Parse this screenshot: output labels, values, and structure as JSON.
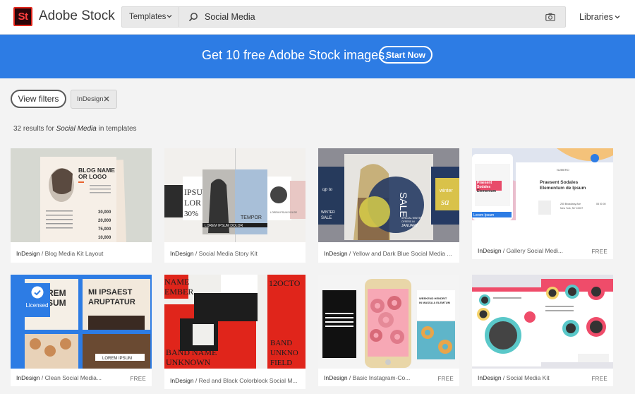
{
  "header": {
    "logo_text": "St",
    "brand": "Adobe Stock",
    "category_select": "Templates",
    "search_value": "Social Media",
    "libraries_label": "Libraries"
  },
  "banner": {
    "text": "Get 10 free Adobe Stock images.",
    "cta": "Start Now"
  },
  "filters": {
    "view_filters_label": "View filters",
    "active_tag": "InDesign"
  },
  "results": {
    "count_prefix": "32 results for ",
    "query": "Social Media",
    "suffix": " in templates"
  },
  "cards": [
    {
      "app": "InDesign",
      "title": " / Blog Media Kit Layout",
      "free": ""
    },
    {
      "app": "InDesign",
      "title": " / Social Media Story Kit",
      "free": ""
    },
    {
      "app": "InDesign",
      "title": " / Yellow and Dark Blue Social Media ...",
      "free": ""
    },
    {
      "app": "InDesign",
      "title": " / Gallery Social Medi...",
      "free": "FREE"
    },
    {
      "app": "InDesign",
      "title": " / Clean Social Media...",
      "free": "FREE",
      "licensed": "Licensed"
    },
    {
      "app": "InDesign",
      "title": " / Red and Black Colorblock Social M...",
      "free": ""
    },
    {
      "app": "InDesign",
      "title": " / Basic Instagram-Co...",
      "free": "FREE"
    },
    {
      "app": "InDesign",
      "title": " / Social Media Kit",
      "free": "FREE"
    }
  ],
  "thumb_text": {
    "card1": [
      "BLOG NAME",
      "OR LOGO",
      "30,000",
      "20,000",
      "75,000",
      "10,000"
    ],
    "card2": [
      "IPSU",
      "LOR",
      "30%",
      "LOREM IPSUM DOLOR",
      "TEMPOR",
      "LOREM IPSUM DOLOR"
    ],
    "card3": [
      "SALE",
      "SPECIAL WINTER",
      "OFFERS IN",
      "JANUARY",
      "winter",
      "sa",
      "WINTER",
      "SALE",
      "up to"
    ],
    "card4": [
      "NUMERO",
      "Praesent Sodales",
      "Elementum de Ipsum",
      "250 Broadway Ave",
      "New York, NY 10007",
      "08 00 00",
      "Praesent",
      "Sodales",
      "Elementum",
      "Lorem Ipsum"
    ],
    "card5": [
      "REM",
      "SUM",
      "MI IPSAEST",
      "ARUPTATUR",
      "LOREM IPSUM"
    ],
    "card6": [
      "NAME",
      "EMBER",
      "12OCTO",
      "BAND NAME",
      "UNKNOWN",
      "BAND",
      "UNKNO",
      "FIELD"
    ],
    "card7": [
      "WEEKEND HENDRIT",
      "IN MASSA A ELEMTUM"
    ],
    "card8": []
  },
  "colors": {
    "banner_blue": "#2d7ce4",
    "logo_red": "#e1251b",
    "logo_bg": "#2b0509",
    "page_bg": "#f3f3f3"
  },
  "icons": {
    "search": "magnifier-icon",
    "camera": "camera-icon",
    "chevron": "chevron-down-icon",
    "close": "close-icon",
    "check": "check-icon"
  }
}
